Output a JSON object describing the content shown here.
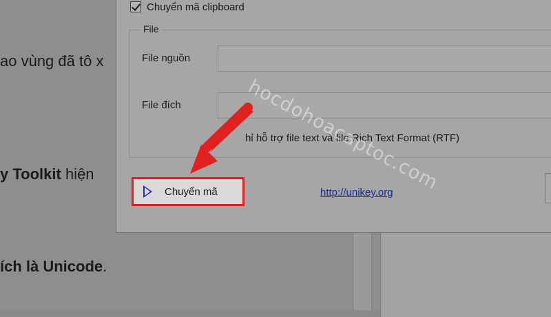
{
  "background_doc": {
    "line1": "ao vùng đã tô x",
    "line2_bold": "y Toolkit",
    "line2_rest": " hiện",
    "line3_prefix": "ích là ",
    "line3_bold": "Unicode",
    "line3_suffix": "."
  },
  "dialog": {
    "clipboard_checkbox": {
      "label": "Chuyển mã clipboard",
      "checked": true
    },
    "file_group": {
      "title": "File",
      "source_label": "File nguồn",
      "source_value": "",
      "dest_label": "File đích",
      "dest_value": "",
      "note": "hỉ hỗ trợ file text và file Rich Text Format (RTF)"
    },
    "convert_button": {
      "label": "Chuyển mã",
      "icon": "play-icon"
    },
    "link": "http://unikey.org"
  },
  "annotation": {
    "arrow_color": "#e12020",
    "highlight_color": "#e12020"
  },
  "watermark": "hocdohoacaptoc.com"
}
